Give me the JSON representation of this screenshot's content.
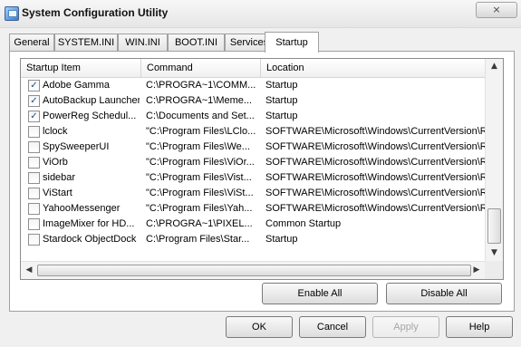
{
  "window": {
    "title": "System Configuration Utility",
    "close_label": "×"
  },
  "tabs": [
    "General",
    "SYSTEM.INI",
    "WIN.INI",
    "BOOT.INI",
    "Services",
    "Startup"
  ],
  "active_tab": "Startup",
  "columns": [
    "Startup Item",
    "Command",
    "Location"
  ],
  "rows": [
    {
      "checked": true,
      "item": "Adobe Gamma",
      "command": "C:\\PROGRA~1\\COMM...",
      "location": "Startup"
    },
    {
      "checked": true,
      "item": "AutoBackup Launcher",
      "command": "C:\\PROGRA~1\\Meme...",
      "location": "Startup"
    },
    {
      "checked": true,
      "item": "PowerReg Schedul...",
      "command": "C:\\Documents and Set...",
      "location": "Startup"
    },
    {
      "checked": false,
      "item": "lclock",
      "command": "\"C:\\Program Files\\LClo...",
      "location": "SOFTWARE\\Microsoft\\Windows\\CurrentVersion\\Ru"
    },
    {
      "checked": false,
      "item": "SpySweeperUI",
      "command": "\"C:\\Program Files\\We...",
      "location": "SOFTWARE\\Microsoft\\Windows\\CurrentVersion\\Ru"
    },
    {
      "checked": false,
      "item": "ViOrb",
      "command": "\"C:\\Program Files\\ViOr...",
      "location": "SOFTWARE\\Microsoft\\Windows\\CurrentVersion\\Ru"
    },
    {
      "checked": false,
      "item": "sidebar",
      "command": "\"C:\\Program Files\\Vist...",
      "location": "SOFTWARE\\Microsoft\\Windows\\CurrentVersion\\Ru"
    },
    {
      "checked": false,
      "item": "ViStart",
      "command": "\"C:\\Program Files\\ViSt...",
      "location": "SOFTWARE\\Microsoft\\Windows\\CurrentVersion\\Ru"
    },
    {
      "checked": false,
      "item": "YahooMessenger",
      "command": "\"C:\\Program Files\\Yah...",
      "location": "SOFTWARE\\Microsoft\\Windows\\CurrentVersion\\Ru"
    },
    {
      "checked": false,
      "item": "ImageMixer for HD...",
      "command": "C:\\PROGRA~1\\PIXEL...",
      "location": "Common Startup"
    },
    {
      "checked": false,
      "item": "Stardock ObjectDock",
      "command": "C:\\Program Files\\Star...",
      "location": "Startup"
    }
  ],
  "buttons": {
    "enable_all": "Enable All",
    "disable_all": "Disable All",
    "ok": "OK",
    "cancel": "Cancel",
    "apply": "Apply",
    "help": "Help"
  },
  "icons": {
    "window": "system-config-icon",
    "checkbox": "check-icon",
    "scroll_up": "arrow-up-icon",
    "scroll_down": "arrow-down-icon",
    "scroll_left": "arrow-left-icon",
    "scroll_right": "arrow-right-icon"
  },
  "colors": {
    "checkmark": "#1c4a86",
    "disabled_text": "#a6a6a6"
  }
}
